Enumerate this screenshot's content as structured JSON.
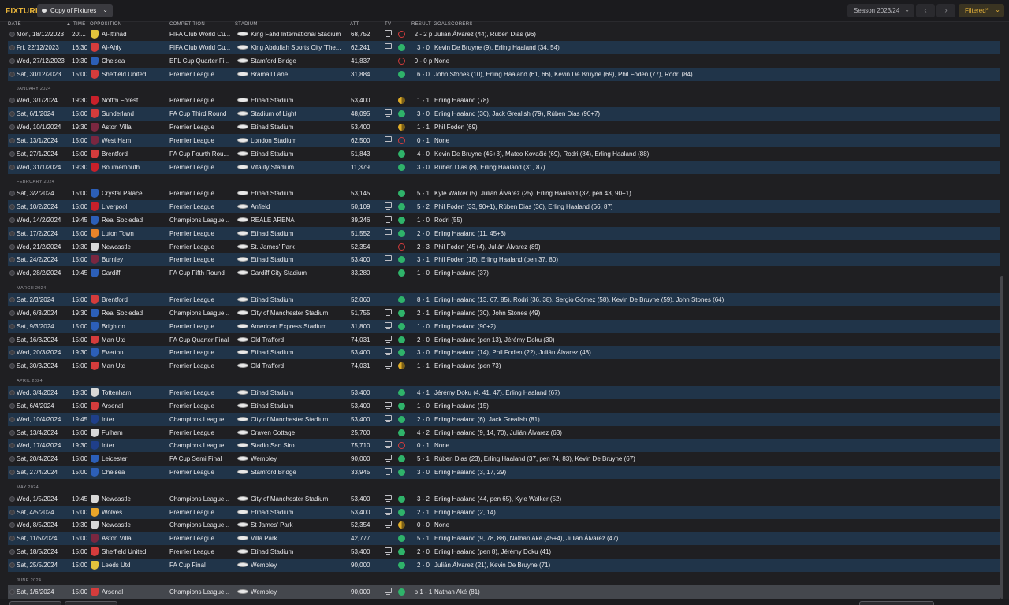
{
  "header": {
    "title": "FIXTURES",
    "view_label": "Copy of Fixtures",
    "season_label": "Season 2023/24",
    "prev_icon": "‹",
    "next_icon": "›",
    "filter_label": "Filtered*"
  },
  "columns": {
    "date": "DATE",
    "time": "TIME",
    "opposition": "OPPOSITION",
    "competition": "COMPETITION",
    "stadium": "STADIUM",
    "att": "ATT",
    "tv": "TV",
    "result": "RESULT",
    "goalscorers": "GOALSCORERS"
  },
  "colors": {
    "accent": "#e8b43a",
    "row_alt": "#203449",
    "win": "#2fb36a",
    "loss": "#d43c3c",
    "draw": "#e0ad28"
  },
  "rows": [
    {
      "type": "match",
      "date": "Mon, 18/12/2023",
      "time": "20:...",
      "opp": "Al-Ittihad",
      "comp": "FIFA Club World Cu...",
      "stadium": "King Fahd International Stadium",
      "att": "68,752",
      "tv": true,
      "res": "L",
      "score": "2 - 2 p",
      "scorers": "Julián Álvarez (44), Rúben Dias (96)",
      "crest": "#e2c33c"
    },
    {
      "type": "match",
      "date": "Fri, 22/12/2023",
      "time": "16:30",
      "opp": "Al-Ahly",
      "comp": "FIFA Club World Cu...",
      "stadium": "King Abdullah Sports City 'The...",
      "att": "62,241",
      "tv": true,
      "res": "W",
      "score": "3 - 0",
      "scorers": "Kevin De Bruyne (9), Erling Haaland (34, 54)",
      "crest": "#d43c3c"
    },
    {
      "type": "match",
      "date": "Wed, 27/12/2023",
      "time": "19:30",
      "opp": "Chelsea",
      "comp": "EFL Cup Quarter Fi...",
      "stadium": "Stamford Bridge",
      "att": "41,837",
      "tv": false,
      "res": "L",
      "score": "0 - 0 p",
      "scorers": "None",
      "crest": "#2c5fb8"
    },
    {
      "type": "match",
      "date": "Sat, 30/12/2023",
      "time": "15:00",
      "opp": "Sheffield United",
      "comp": "Premier League",
      "stadium": "Bramall Lane",
      "att": "31,884",
      "tv": false,
      "res": "W",
      "score": "6 - 0",
      "scorers": "John Stones (10), Erling Haaland (61, 66), Kevin De Bruyne (69), Phil Foden (77), Rodri (84)",
      "crest": "#d43c3c"
    },
    {
      "type": "section",
      "label": "JANUARY 2024"
    },
    {
      "type": "match",
      "date": "Wed, 3/1/2024",
      "time": "19:30",
      "opp": "Nottm Forest",
      "comp": "Premier League",
      "stadium": "Etihad Stadium",
      "att": "53,400",
      "tv": false,
      "res": "D",
      "score": "1 - 1",
      "scorers": "Erling Haaland (78)",
      "crest": "#c8202a"
    },
    {
      "type": "match",
      "date": "Sat, 6/1/2024",
      "time": "15:00",
      "opp": "Sunderland",
      "comp": "FA Cup Third Round",
      "stadium": "Stadium of Light",
      "att": "48,095",
      "tv": true,
      "res": "W",
      "score": "3 - 0",
      "scorers": "Erling Haaland (36), Jack Grealish (79), Rúben Dias (90+7)",
      "crest": "#d43c3c"
    },
    {
      "type": "match",
      "date": "Wed, 10/1/2024",
      "time": "19:30",
      "opp": "Aston Villa",
      "comp": "Premier League",
      "stadium": "Etihad Stadium",
      "att": "53,400",
      "tv": false,
      "res": "D",
      "score": "1 - 1",
      "scorers": "Phil Foden (69)",
      "crest": "#7a2740"
    },
    {
      "type": "match",
      "date": "Sat, 13/1/2024",
      "time": "15:00",
      "opp": "West Ham",
      "comp": "Premier League",
      "stadium": "London Stadium",
      "att": "62,500",
      "tv": true,
      "res": "L",
      "score": "0 - 1",
      "scorers": "None",
      "crest": "#7a2740"
    },
    {
      "type": "match",
      "date": "Sat, 27/1/2024",
      "time": "15:00",
      "opp": "Brentford",
      "comp": "FA Cup Fourth Rou...",
      "stadium": "Etihad Stadium",
      "att": "51,843",
      "tv": false,
      "res": "W",
      "score": "4 - 0",
      "scorers": "Kevin De Bruyne (45+3), Mateo Kovačić (69), Rodri (84), Erling Haaland (88)",
      "crest": "#d43c3c"
    },
    {
      "type": "match",
      "date": "Wed, 31/1/2024",
      "time": "19:30",
      "opp": "Bournemouth",
      "comp": "Premier League",
      "stadium": "Vitality Stadium",
      "att": "11,379",
      "tv": false,
      "res": "W",
      "score": "3 - 0",
      "scorers": "Rúben Dias (8), Erling Haaland (31, 87)",
      "crest": "#c8202a"
    },
    {
      "type": "section",
      "label": "FEBRUARY 2024"
    },
    {
      "type": "match",
      "date": "Sat, 3/2/2024",
      "time": "15:00",
      "opp": "Crystal Palace",
      "comp": "Premier League",
      "stadium": "Etihad Stadium",
      "att": "53,145",
      "tv": false,
      "res": "W",
      "score": "5 - 1",
      "scorers": "Kyle Walker (5), Julián Álvarez (25), Erling Haaland (32, pen 43, 90+1)",
      "crest": "#2c5fb8"
    },
    {
      "type": "match",
      "date": "Sat, 10/2/2024",
      "time": "15:00",
      "opp": "Liverpool",
      "comp": "Premier League",
      "stadium": "Anfield",
      "att": "50,109",
      "tv": true,
      "res": "W",
      "score": "5 - 2",
      "scorers": "Phil Foden (33, 90+1), Rúben Dias (36), Erling Haaland (66, 87)",
      "crest": "#c8202a"
    },
    {
      "type": "match",
      "date": "Wed, 14/2/2024",
      "time": "19:45",
      "opp": "Real Sociedad",
      "comp": "Champions League...",
      "stadium": "REALE ARENA",
      "att": "39,246",
      "tv": true,
      "res": "W",
      "score": "1 - 0",
      "scorers": "Rodri (55)",
      "crest": "#2c5fb8"
    },
    {
      "type": "match",
      "date": "Sat, 17/2/2024",
      "time": "15:00",
      "opp": "Luton Town",
      "comp": "Premier League",
      "stadium": "Etihad Stadium",
      "att": "51,552",
      "tv": true,
      "res": "W",
      "score": "2 - 0",
      "scorers": "Erling Haaland (11, 45+3)",
      "crest": "#e8842a"
    },
    {
      "type": "match",
      "date": "Wed, 21/2/2024",
      "time": "19:30",
      "opp": "Newcastle",
      "comp": "Premier League",
      "stadium": "St. James' Park",
      "att": "52,354",
      "tv": false,
      "res": "L",
      "score": "2 - 3",
      "scorers": "Phil Foden (45+4), Julián Álvarez (89)",
      "crest": "#d8d8d8"
    },
    {
      "type": "match",
      "date": "Sat, 24/2/2024",
      "time": "15:00",
      "opp": "Burnley",
      "comp": "Premier League",
      "stadium": "Etihad Stadium",
      "att": "53,400",
      "tv": true,
      "res": "W",
      "score": "3 - 1",
      "scorers": "Phil Foden (18), Erling Haaland (pen 37, 80)",
      "crest": "#7a2740"
    },
    {
      "type": "match",
      "date": "Wed, 28/2/2024",
      "time": "19:45",
      "opp": "Cardiff",
      "comp": "FA Cup Fifth Round",
      "stadium": "Cardiff City Stadium",
      "att": "33,280",
      "tv": false,
      "res": "W",
      "score": "1 - 0",
      "scorers": "Erling Haaland (37)",
      "crest": "#2c5fb8"
    },
    {
      "type": "section",
      "label": "MARCH 2024"
    },
    {
      "type": "match",
      "date": "Sat, 2/3/2024",
      "time": "15:00",
      "opp": "Brentford",
      "comp": "Premier League",
      "stadium": "Etihad Stadium",
      "att": "52,060",
      "tv": false,
      "res": "W",
      "score": "8 - 1",
      "scorers": "Erling Haaland (13, 67, 85), Rodri (36, 38), Sergio Gómez (58), Kevin De Bruyne (59), John Stones (64)",
      "crest": "#d43c3c"
    },
    {
      "type": "match",
      "date": "Wed, 6/3/2024",
      "time": "19:30",
      "opp": "Real Sociedad",
      "comp": "Champions League...",
      "stadium": "City of Manchester Stadium",
      "att": "51,755",
      "tv": true,
      "res": "W",
      "score": "2 - 1",
      "scorers": "Erling Haaland (30), John Stones (49)",
      "crest": "#2c5fb8"
    },
    {
      "type": "match",
      "date": "Sat, 9/3/2024",
      "time": "15:00",
      "opp": "Brighton",
      "comp": "Premier League",
      "stadium": "American Express Stadium",
      "att": "31,800",
      "tv": true,
      "res": "W",
      "score": "1 - 0",
      "scorers": "Erling Haaland (90+2)",
      "crest": "#2c5fb8"
    },
    {
      "type": "match",
      "date": "Sat, 16/3/2024",
      "time": "15:00",
      "opp": "Man Utd",
      "comp": "FA Cup Quarter Final",
      "stadium": "Old Trafford",
      "att": "74,031",
      "tv": true,
      "res": "W",
      "score": "2 - 0",
      "scorers": "Erling Haaland (pen 13), Jérémy Doku (30)",
      "crest": "#d43c3c"
    },
    {
      "type": "match",
      "date": "Wed, 20/3/2024",
      "time": "19:30",
      "opp": "Everton",
      "comp": "Premier League",
      "stadium": "Etihad Stadium",
      "att": "53,400",
      "tv": true,
      "res": "W",
      "score": "3 - 0",
      "scorers": "Erling Haaland (14), Phil Foden (22), Julián Álvarez (48)",
      "crest": "#2c5fb8"
    },
    {
      "type": "match",
      "date": "Sat, 30/3/2024",
      "time": "15:00",
      "opp": "Man Utd",
      "comp": "Premier League",
      "stadium": "Old Trafford",
      "att": "74,031",
      "tv": true,
      "res": "D",
      "score": "1 - 1",
      "scorers": "Erling Haaland (pen 73)",
      "crest": "#d43c3c"
    },
    {
      "type": "section",
      "label": "APRIL 2024"
    },
    {
      "type": "match",
      "date": "Wed, 3/4/2024",
      "time": "19:30",
      "opp": "Tottenham",
      "comp": "Premier League",
      "stadium": "Etihad Stadium",
      "att": "53,400",
      "tv": false,
      "res": "W",
      "score": "4 - 1",
      "scorers": "Jérémy Doku (4, 41, 47), Erling Haaland (67)",
      "crest": "#d8d8d8"
    },
    {
      "type": "match",
      "date": "Sat, 6/4/2024",
      "time": "15:00",
      "opp": "Arsenal",
      "comp": "Premier League",
      "stadium": "Etihad Stadium",
      "att": "53,400",
      "tv": true,
      "res": "W",
      "score": "1 - 0",
      "scorers": "Erling Haaland (15)",
      "crest": "#d43c3c"
    },
    {
      "type": "match",
      "date": "Wed, 10/4/2024",
      "time": "19:45",
      "opp": "Inter",
      "comp": "Champions League...",
      "stadium": "City of Manchester Stadium",
      "att": "53,400",
      "tv": true,
      "res": "W",
      "score": "2 - 0",
      "scorers": "Erling Haaland (6), Jack Grealish (81)",
      "crest": "#1f3f8a"
    },
    {
      "type": "match",
      "date": "Sat, 13/4/2024",
      "time": "15:00",
      "opp": "Fulham",
      "comp": "Premier League",
      "stadium": "Craven Cottage",
      "att": "25,700",
      "tv": false,
      "res": "W",
      "score": "4 - 2",
      "scorers": "Erling Haaland (9, 14, 70), Julián Álvarez (63)",
      "crest": "#d8d8d8"
    },
    {
      "type": "match",
      "date": "Wed, 17/4/2024",
      "time": "19:30",
      "opp": "Inter",
      "comp": "Champions League...",
      "stadium": "Stadio San Siro",
      "att": "75,710",
      "tv": true,
      "res": "L",
      "score": "0 - 1",
      "scorers": "None",
      "crest": "#1f3f8a"
    },
    {
      "type": "match",
      "date": "Sat, 20/4/2024",
      "time": "15:00",
      "opp": "Leicester",
      "comp": "FA Cup Semi Final",
      "stadium": "Wembley",
      "att": "90,000",
      "tv": true,
      "res": "W",
      "score": "5 - 1",
      "scorers": "Rúben Dias (23), Erling Haaland (37, pen 74, 83), Kevin De Bruyne (67)",
      "crest": "#2c5fb8"
    },
    {
      "type": "match",
      "date": "Sat, 27/4/2024",
      "time": "15:00",
      "opp": "Chelsea",
      "comp": "Premier League",
      "stadium": "Stamford Bridge",
      "att": "33,945",
      "tv": true,
      "res": "W",
      "score": "3 - 0",
      "scorers": "Erling Haaland (3, 17, 29)",
      "crest": "#2c5fb8"
    },
    {
      "type": "section",
      "label": "MAY 2024"
    },
    {
      "type": "match",
      "date": "Wed, 1/5/2024",
      "time": "19:45",
      "opp": "Newcastle",
      "comp": "Champions League...",
      "stadium": "City of Manchester Stadium",
      "att": "53,400",
      "tv": true,
      "res": "W",
      "score": "3 - 2",
      "scorers": "Erling Haaland (44, pen 65), Kyle Walker (52)",
      "crest": "#d8d8d8"
    },
    {
      "type": "match",
      "date": "Sat, 4/5/2024",
      "time": "15:00",
      "opp": "Wolves",
      "comp": "Premier League",
      "stadium": "Etihad Stadium",
      "att": "53,400",
      "tv": true,
      "res": "W",
      "score": "2 - 1",
      "scorers": "Erling Haaland (2, 14)",
      "crest": "#e8a52a"
    },
    {
      "type": "match",
      "date": "Wed, 8/5/2024",
      "time": "19:30",
      "opp": "Newcastle",
      "comp": "Champions League...",
      "stadium": "St James' Park",
      "att": "52,354",
      "tv": true,
      "res": "D",
      "score": "0 - 0",
      "scorers": "None",
      "crest": "#d8d8d8"
    },
    {
      "type": "match",
      "date": "Sat, 11/5/2024",
      "time": "15:00",
      "opp": "Aston Villa",
      "comp": "Premier League",
      "stadium": "Villa Park",
      "att": "42,777",
      "tv": false,
      "res": "W",
      "score": "5 - 1",
      "scorers": "Erling Haaland (9, 78, 88), Nathan Aké (45+4), Julián Álvarez (47)",
      "crest": "#7a2740"
    },
    {
      "type": "match",
      "date": "Sat, 18/5/2024",
      "time": "15:00",
      "opp": "Sheffield United",
      "comp": "Premier League",
      "stadium": "Etihad Stadium",
      "att": "53,400",
      "tv": true,
      "res": "W",
      "score": "2 - 0",
      "scorers": "Erling Haaland (pen 8), Jérémy Doku (41)",
      "crest": "#d43c3c"
    },
    {
      "type": "match",
      "date": "Sat, 25/5/2024",
      "time": "15:00",
      "opp": "Leeds Utd",
      "comp": "FA Cup Final",
      "stadium": "Wembley",
      "att": "90,000",
      "tv": false,
      "res": "W",
      "score": "2 - 0",
      "scorers": "Julián Álvarez (21), Kevin De Bruyne (71)",
      "crest": "#e2c33c"
    },
    {
      "type": "section",
      "label": "JUNE 2024"
    },
    {
      "type": "match",
      "date": "Sat, 1/6/2024",
      "time": "15:00",
      "opp": "Arsenal",
      "comp": "Champions League...",
      "stadium": "Wembley",
      "att": "90,000",
      "tv": true,
      "res": "P",
      "score": "p 1 - 1",
      "scorers": "Nathan Aké (81)",
      "crest": "#d43c3c",
      "selected": true
    }
  ]
}
